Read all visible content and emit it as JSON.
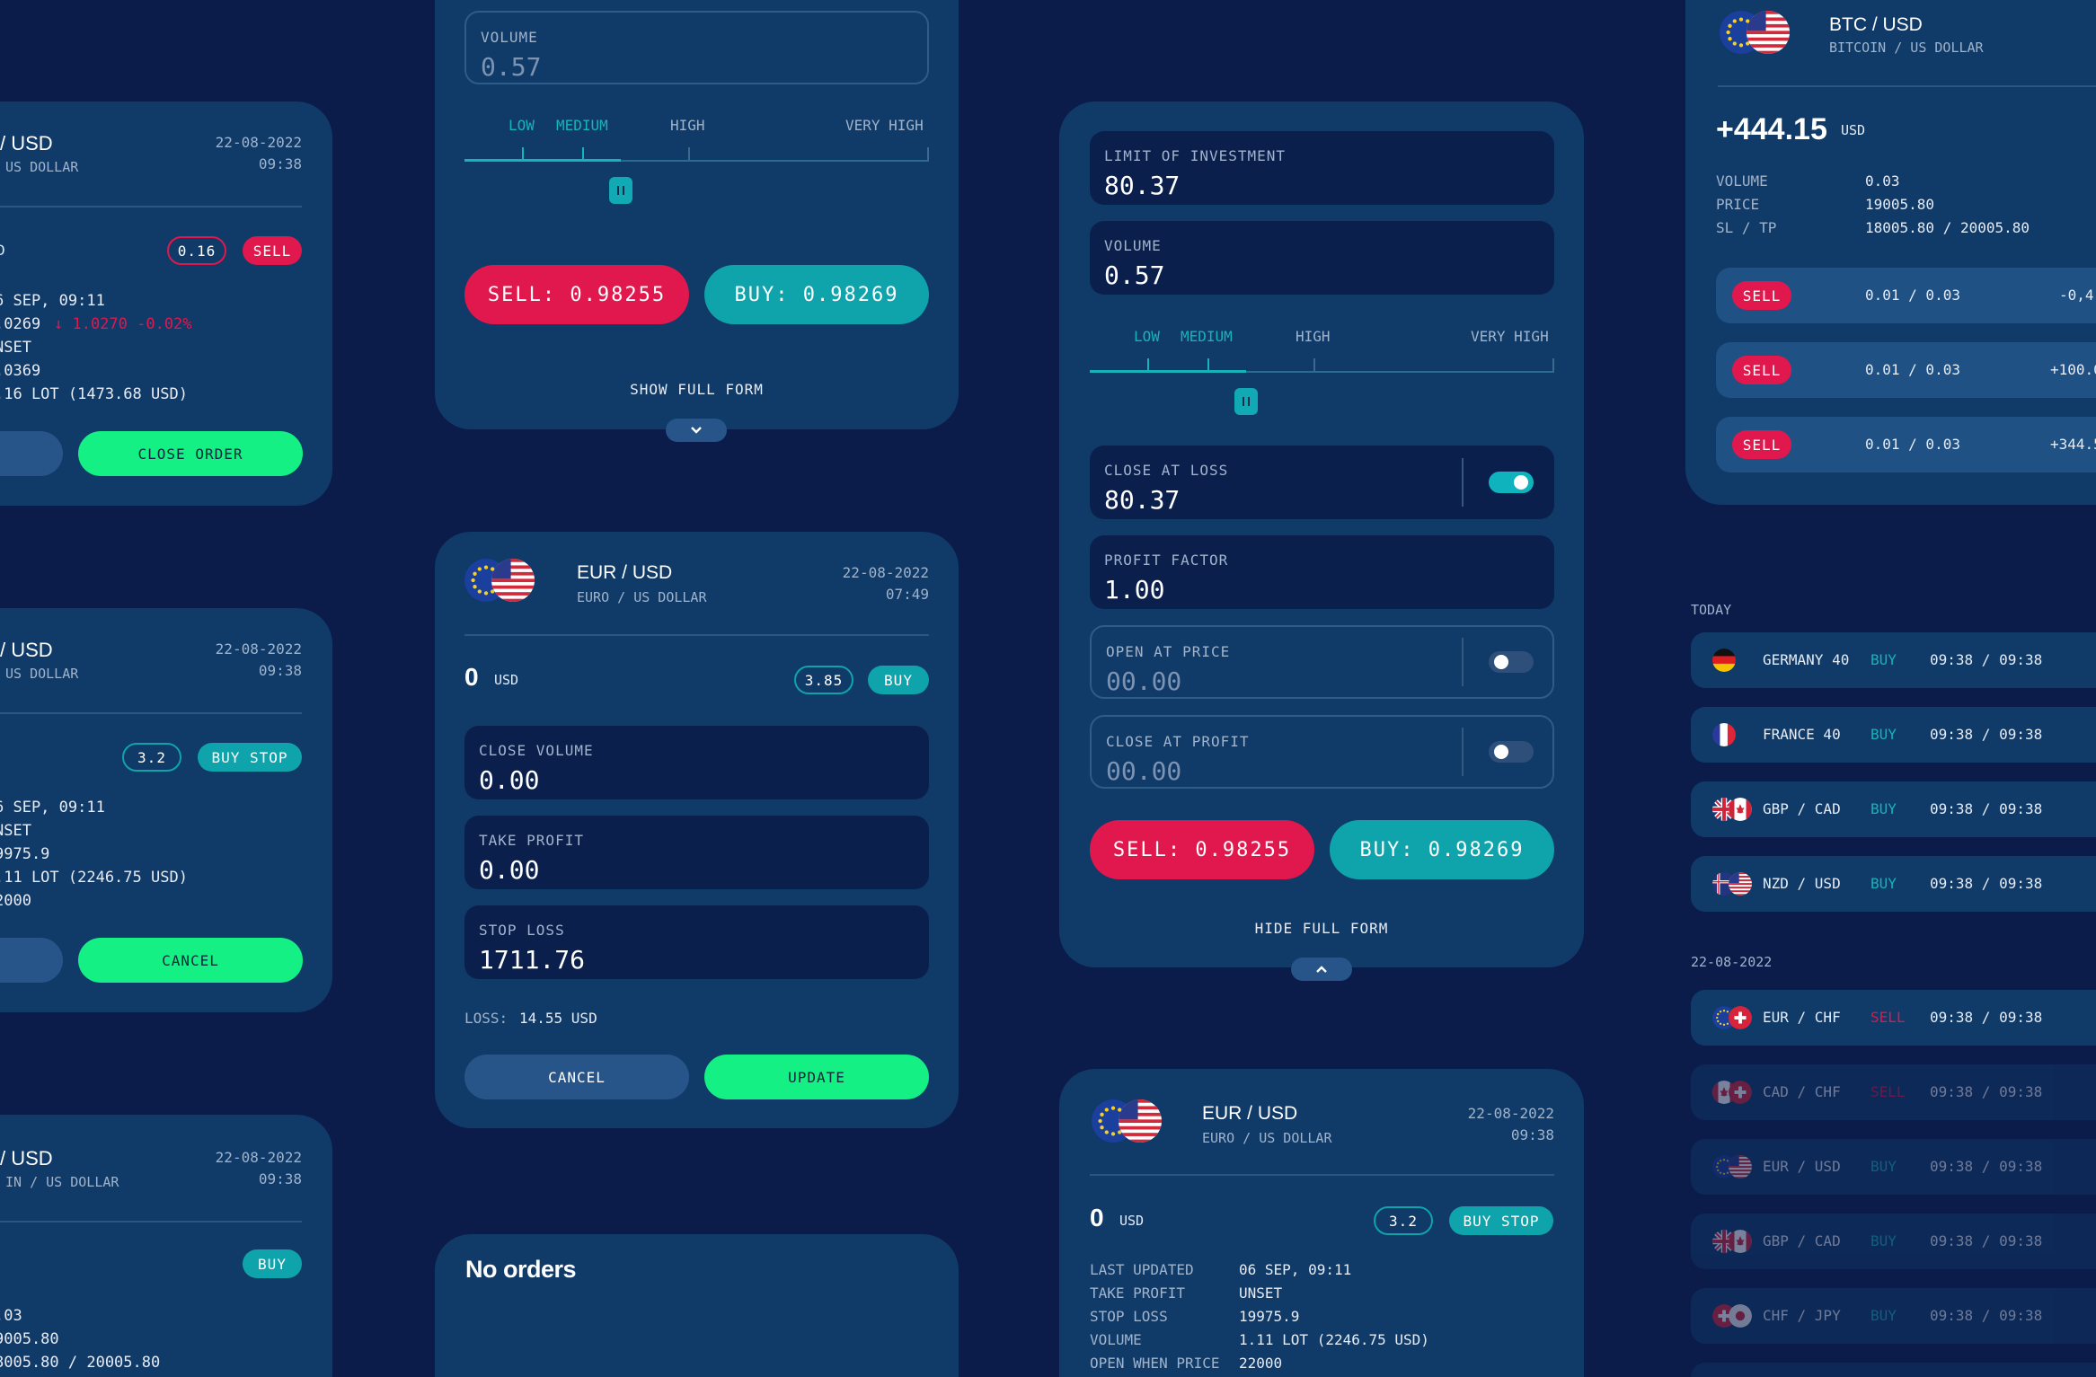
{
  "colors": {
    "background": "#0b1b4a",
    "card": "#103a68",
    "sell": "#e0184d",
    "buy": "#0fa3ac",
    "confirm": "#14f083"
  },
  "common": {
    "sell_button": "SELL:  0.98255",
    "buy_button": "BUY:   0.98269",
    "risk_levels": [
      "LOW",
      "MEDIUM",
      "HIGH",
      "VERY HIGH"
    ],
    "currency": "USD",
    "date": "22-08-2022"
  },
  "left": {
    "card1": {
      "pair": "/ USD",
      "sub": "US DOLLAR",
      "date": "22-08-2022",
      "time": "09:38",
      "amount_prefix": "D",
      "volume_badge": "0.16",
      "type_badge": "SELL",
      "lines": [
        "6 SEP, 09:11",
        ".0269",
        "NSET",
        ".0369",
        ".16 LOT (1473.68 USD)"
      ],
      "change": "↓ 1.0270 -0.02%",
      "close_label": "CLOSE ORDER"
    },
    "card2": {
      "pair": "/ USD",
      "sub": "US DOLLAR",
      "date": "22-08-2022",
      "time": "09:38",
      "volume_badge": "3.2",
      "type_badge": "BUY STOP",
      "lines": [
        "6 SEP, 09:11",
        "NSET",
        "9975.9",
        ".11 LOT (2246.75 USD)",
        "2000"
      ],
      "cancel_label": "CANCEL"
    },
    "card3": {
      "pair": "/ USD",
      "sub": "IN / US DOLLAR",
      "date": "22-08-2022",
      "time": "09:38",
      "type_badge": "BUY",
      "lines": [
        ".03",
        "9005.80",
        "8005.80 / 20005.80"
      ]
    }
  },
  "mid": {
    "top": {
      "volume_label": "VOLUME",
      "volume_value": "0.57",
      "show_form": "SHOW FULL FORM"
    },
    "edit": {
      "pair": "EUR / USD",
      "sub": "EURO / US DOLLAR",
      "date": "22-08-2022",
      "time": "07:49",
      "amount": "0",
      "volume_badge": "3.85",
      "type_badge": "BUY",
      "close_volume_label": "CLOSE VOLUME",
      "close_volume": "0.00",
      "take_profit_label": "TAKE PROFIT",
      "take_profit": "0.00",
      "stop_loss_label": "STOP LOSS",
      "stop_loss": "1711.76",
      "loss_label": "LOSS:",
      "loss_value": "14.55 USD",
      "cancel": "CANCEL",
      "update": "UPDATE"
    },
    "empty": {
      "title": "No orders"
    }
  },
  "form": {
    "limit_label": "LIMIT OF INVESTMENT",
    "limit_value": "80.37",
    "volume_label": "VOLUME",
    "volume_value": "0.57",
    "close_loss_label": "CLOSE AT LOSS",
    "close_loss_value": "80.37",
    "profit_factor_label": "PROFIT FACTOR",
    "profit_factor_value": "1.00",
    "open_price_label": "OPEN AT PRICE",
    "open_price_value": "00.00",
    "close_profit_label": "CLOSE AT PROFIT",
    "close_profit_value": "00.00",
    "hide_form": "HIDE FULL FORM"
  },
  "detail": {
    "pair": "EUR / USD",
    "sub": "EURO / US DOLLAR",
    "date": "22-08-2022",
    "time": "09:38",
    "amount": "0",
    "volume_badge": "3.2",
    "type_badge": "BUY STOP",
    "rows": [
      {
        "k": "LAST UPDATED",
        "v": "06 SEP, 09:11"
      },
      {
        "k": "TAKE PROFIT",
        "v": "UNSET"
      },
      {
        "k": "STOP LOSS",
        "v": "19975.9"
      },
      {
        "k": "VOLUME",
        "v": "1.11 LOT (2246.75 USD)"
      },
      {
        "k": "OPEN WHEN PRICE",
        "v": "22000"
      }
    ]
  },
  "right": {
    "btc": {
      "pair": "BTC / USD",
      "sub": "BITCOIN / US DOLLAR",
      "profit": "+444.15",
      "unit": "USD",
      "rows": [
        {
          "k": "VOLUME",
          "v": "0.03"
        },
        {
          "k": "PRICE",
          "v": "19005.80"
        },
        {
          "k": "SL / TP",
          "v": "18005.80 / 20005.80"
        }
      ],
      "orders": [
        {
          "type": "SELL",
          "lots": "0.01 / 0.03",
          "pl": "-0,4"
        },
        {
          "type": "SELL",
          "lots": "0.01 / 0.03",
          "pl": "+100.0"
        },
        {
          "type": "SELL",
          "lots": "0.01 / 0.03",
          "pl": "+344.5"
        }
      ]
    },
    "today_label": "TODAY",
    "today": [
      {
        "name": "GERMANY 40",
        "type": "BUY",
        "time": "09:38 / 09:38",
        "flag": "de-flag-icon"
      },
      {
        "name": "FRANCE 40",
        "type": "BUY",
        "time": "09:38 / 09:38",
        "flag": "fr-flag-icon"
      },
      {
        "name": "GBP / CAD",
        "type": "BUY",
        "time": "09:38 / 09:38",
        "flag": "gb-ca-flag-icon"
      },
      {
        "name": "NZD / USD",
        "type": "BUY",
        "time": "09:38 / 09:38",
        "flag": "nz-us-flag-icon"
      }
    ],
    "date_label": "22-08-2022",
    "dated": [
      {
        "name": "EUR / CHF",
        "type": "SELL",
        "time": "09:38 / 09:38"
      },
      {
        "name": "CAD / CHF",
        "type": "SELL",
        "time": "09:38 / 09:38"
      },
      {
        "name": "EUR / USD",
        "type": "BUY",
        "time": "09:38 / 09:38"
      },
      {
        "name": "GBP / CAD",
        "type": "BUY",
        "time": "09:38 / 09:38"
      },
      {
        "name": "CHF / JPY",
        "type": "BUY",
        "time": "09:38 / 09:38"
      }
    ]
  }
}
